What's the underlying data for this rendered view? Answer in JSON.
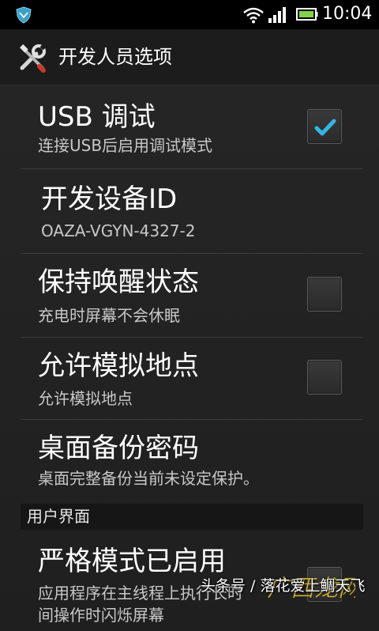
{
  "status_bar": {
    "time": "10:04",
    "icons": [
      "shield-icon",
      "wifi-icon",
      "signal-icon",
      "battery-icon"
    ]
  },
  "title_bar": {
    "title": "开发人员选项",
    "icon": "tools-icon"
  },
  "preferences": [
    {
      "title": "USB 调试",
      "summary": "连接USB后启用调试模式",
      "checkbox": true,
      "checked": true
    },
    {
      "title": "开发设备ID",
      "summary": "OAZA-VGYN-4327-2",
      "checkbox": false
    },
    {
      "title": "保持唤醒状态",
      "summary": "充电时屏幕不会休眠",
      "checkbox": true,
      "checked": false
    },
    {
      "title": "允许模拟地点",
      "summary": "允许模拟地点",
      "checkbox": true,
      "checked": false
    },
    {
      "title": "桌面备份密码",
      "summary": "桌面完整备份当前未设定保护。",
      "checkbox": false
    }
  ],
  "section_header": "用户界面",
  "strict_mode": {
    "title": "严格模式已启用",
    "summary_line1": "应用程序在主线程上执行长时",
    "summary_line2": "间操作时闪烁屏幕",
    "checkbox": true,
    "checked": false
  },
  "watermark": {
    "text": "头条号 / 落花爱上鲷天飞",
    "logo_text": "广西龙网"
  },
  "colors": {
    "background": "#1f1f1f",
    "check_accent": "#33b5e5",
    "summary_text": "#c8c8c8"
  }
}
